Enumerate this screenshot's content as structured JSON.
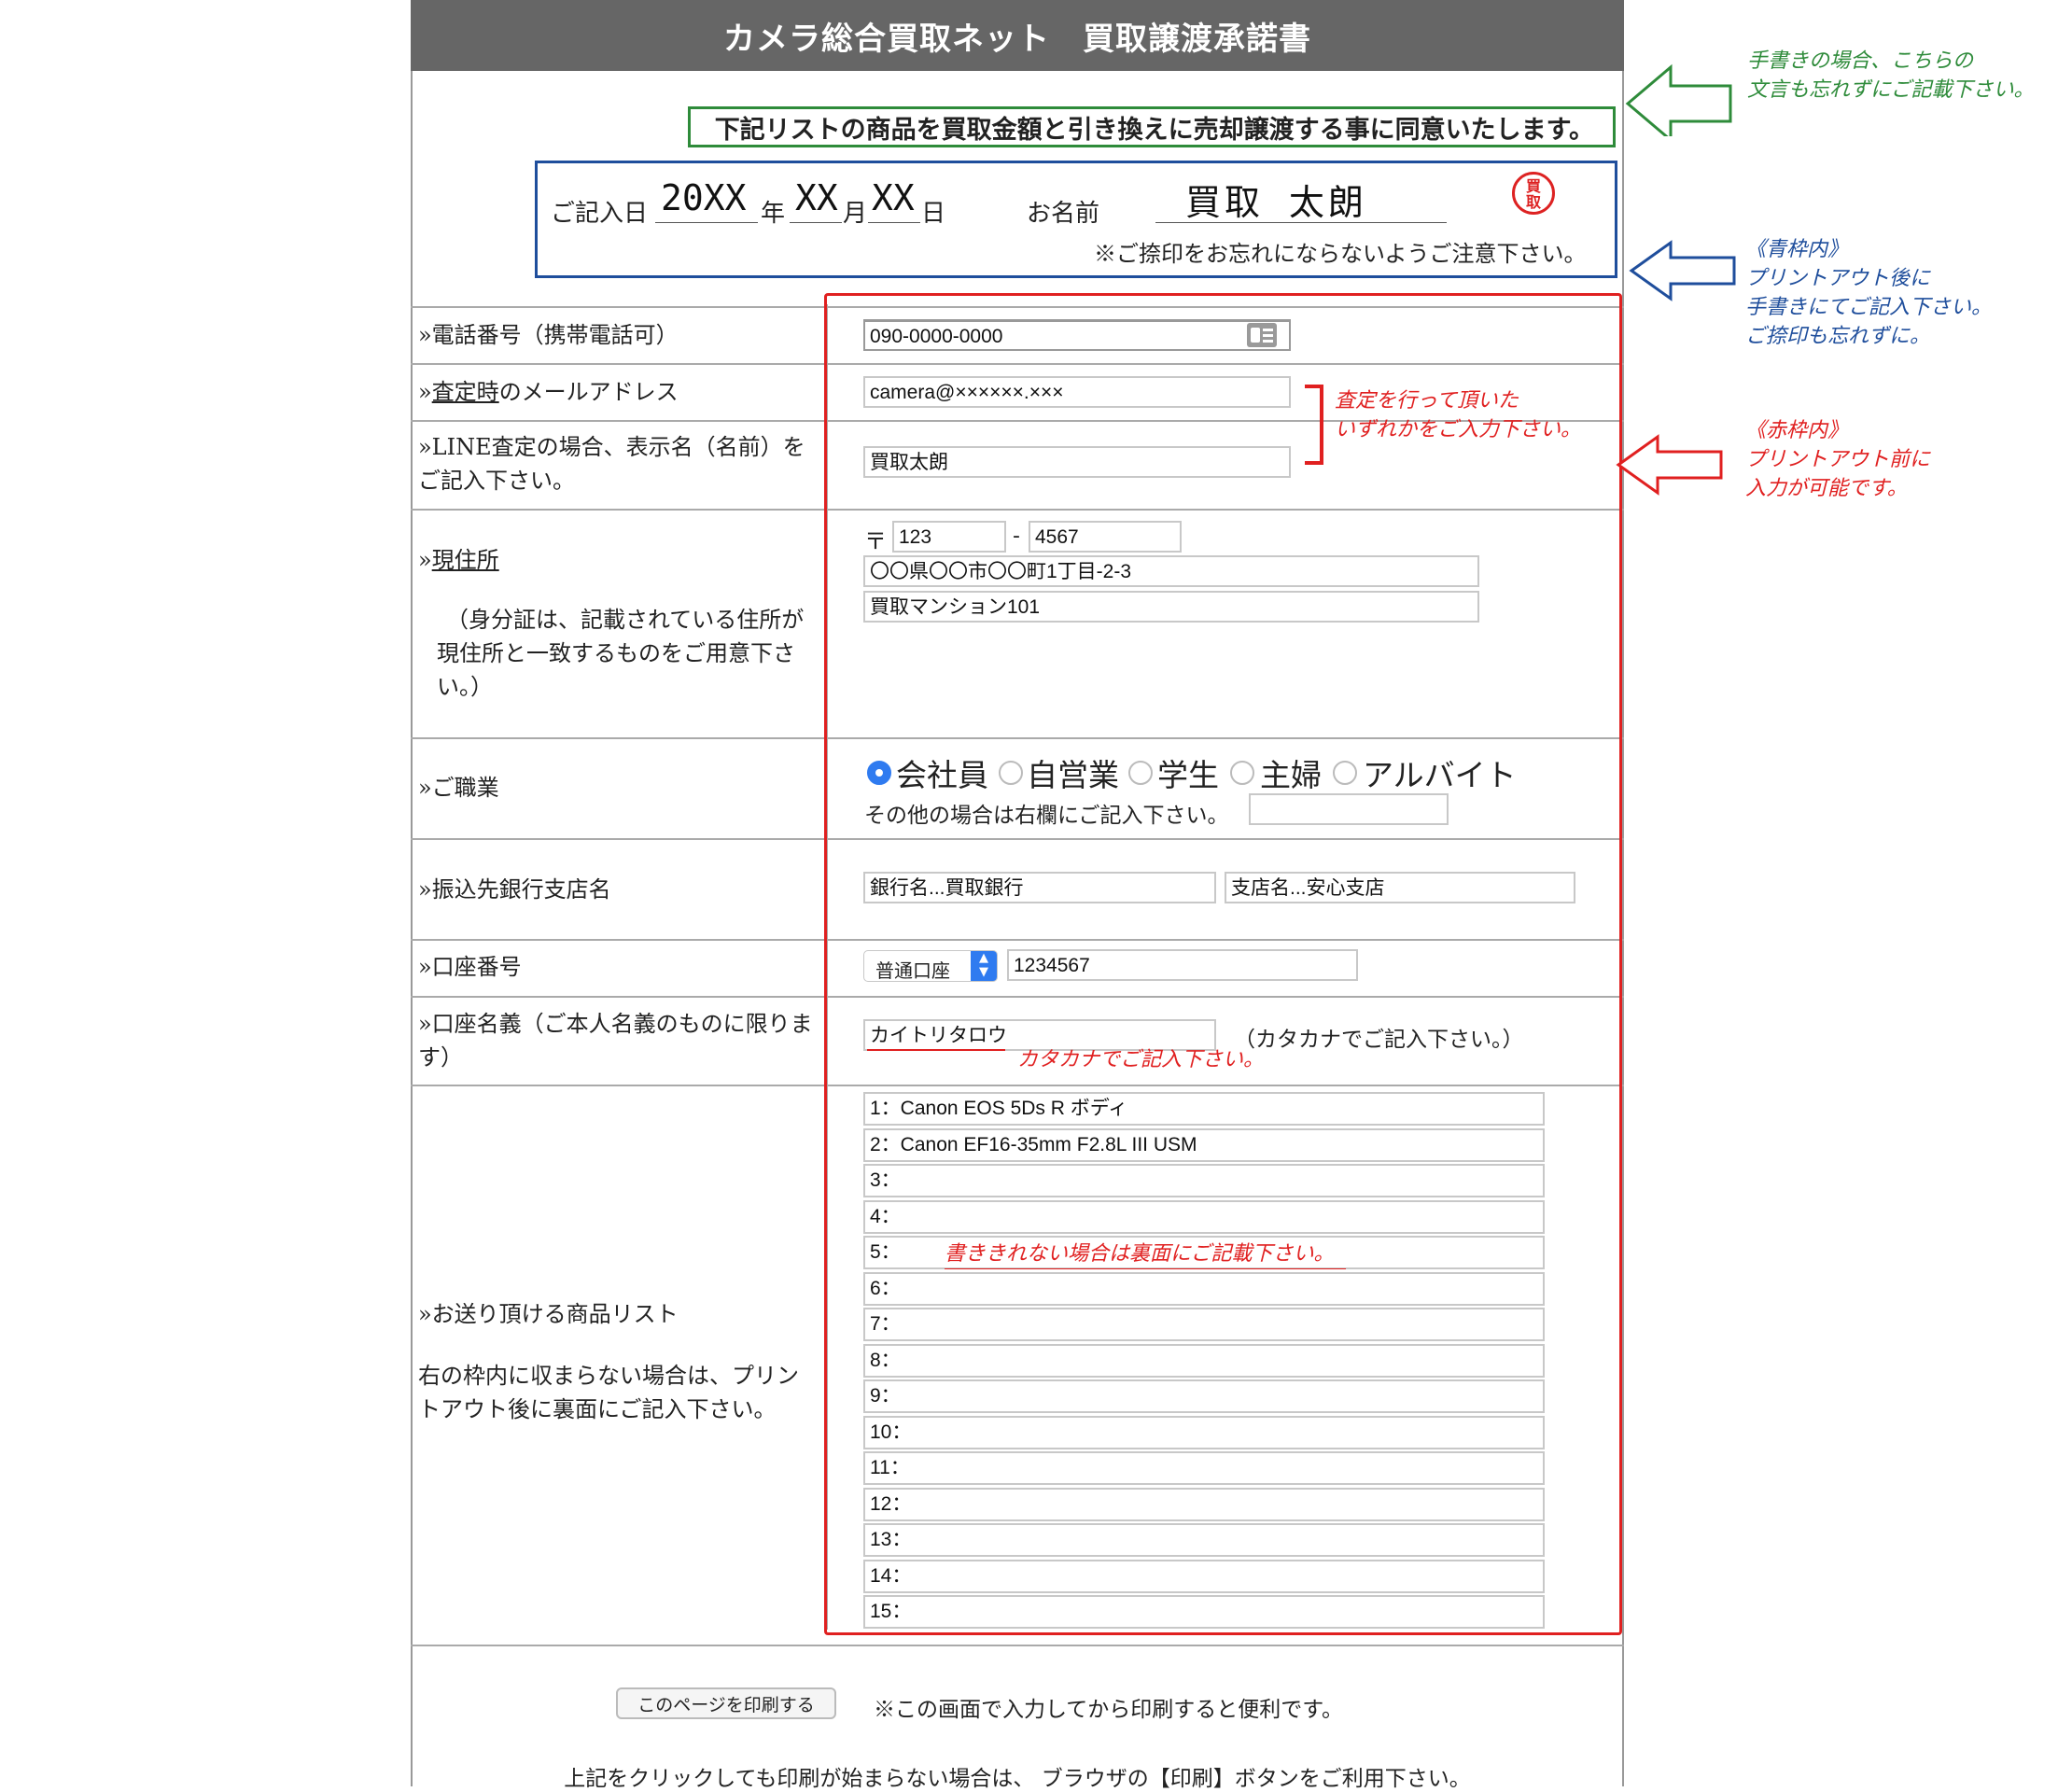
{
  "title": "カメラ総合買取ネット　買取譲渡承諾書",
  "agreement": "下記リストの商品を買取金額と引き換えに売却譲渡する事に同意いたします。",
  "date": {
    "label": "ご記入日",
    "year": "20XX",
    "year_unit": "年",
    "month": "XX",
    "month_unit": "月",
    "day": "XX",
    "day_unit": "日"
  },
  "name": {
    "label": "お名前",
    "value": "買取 太朗",
    "seal": [
      "買",
      "取"
    ]
  },
  "seal_note": "※ご捺印をお忘れにならないようご注意下さい。",
  "phone": {
    "label": "»電話番号（携帯電話可）",
    "value": "090-0000-0000",
    "icon": "contact-card-icon"
  },
  "email": {
    "label_prefix": "»",
    "label_underlined": "査定時",
    "label_suffix": "のメールアドレス",
    "value": "camera@××××××.×××"
  },
  "line": {
    "label": "»LINE査定の場合、表示名（名前）をご記入下さい。",
    "value": "買取太朗"
  },
  "address": {
    "label_prefix": "»",
    "label_underlined": "現住所",
    "note": "（身分証は、記載されている住所が現住所と一致するものをご用意下さい。）",
    "postal_mark": "〒",
    "zip1": "123",
    "zip_sep": "-",
    "zip2": "4567",
    "line1": "〇〇県〇〇市〇〇町1丁目-2-3",
    "line2": "買取マンション101"
  },
  "job": {
    "label": "»ご職業",
    "options": [
      "会社員",
      "自営業",
      "学生",
      "主婦",
      "アルバイト"
    ],
    "selected": "会社員",
    "other_label": "その他の場合は右欄にご記入下さい。",
    "other_value": ""
  },
  "bank": {
    "label": "»振込先銀行支店名",
    "bank_value": "銀行名...買取銀行",
    "branch_value": "支店名...安心支店"
  },
  "account": {
    "label": "»口座番号",
    "type": "普通口座",
    "number": "1234567"
  },
  "holder": {
    "label": "»口座名義（ご本人名義のものに限ります）",
    "value": "カイトリタロウ",
    "hint": "（カタカナでご記入下さい。）"
  },
  "items": {
    "label": "»お送り頂ける商品リスト",
    "note": "右の枠内に収まらない場合は、プリントアウト後に裏面にご記入下さい。",
    "rows": [
      "1：Canon EOS 5Ds R ボディ",
      "2：Canon EF16-35mm F2.8L III USM",
      "3：",
      "4：",
      "5：",
      "6：",
      "7：",
      "8：",
      "9：",
      "10：",
      "11：",
      "12：",
      "13：",
      "14：",
      "15："
    ]
  },
  "print": {
    "button": "このページを印刷する",
    "note": "※この画面で入力してから印刷すると便利です。",
    "footer": "上記をクリックしても印刷が始まらない場合は、 ブラウザの【印刷】ボタンをご利用下さい。"
  },
  "annotations": {
    "green": [
      "手書きの場合、こちらの",
      "文言も忘れずにご記載下さい。"
    ],
    "blue": [
      "《青枠内》",
      "プリントアウト後に",
      "手書きにてご記入下さい。",
      "ご捺印も忘れずに。"
    ],
    "red_side": [
      "《赤枠内》",
      "プリントアウト前に",
      "入力が可能です。"
    ],
    "red_email": [
      "査定を行って頂いた",
      "いずれかをご入力下さい。"
    ],
    "red_katakana": "カタカナでご記入下さい。",
    "red_items": "書ききれない場合は裏面にご記載下さい。"
  },
  "colors": {
    "green": "#2e8b3a",
    "blue": "#1f4e9c",
    "red": "#e02020",
    "header_bg": "#666666",
    "radio_on": "#2f7bf0"
  }
}
